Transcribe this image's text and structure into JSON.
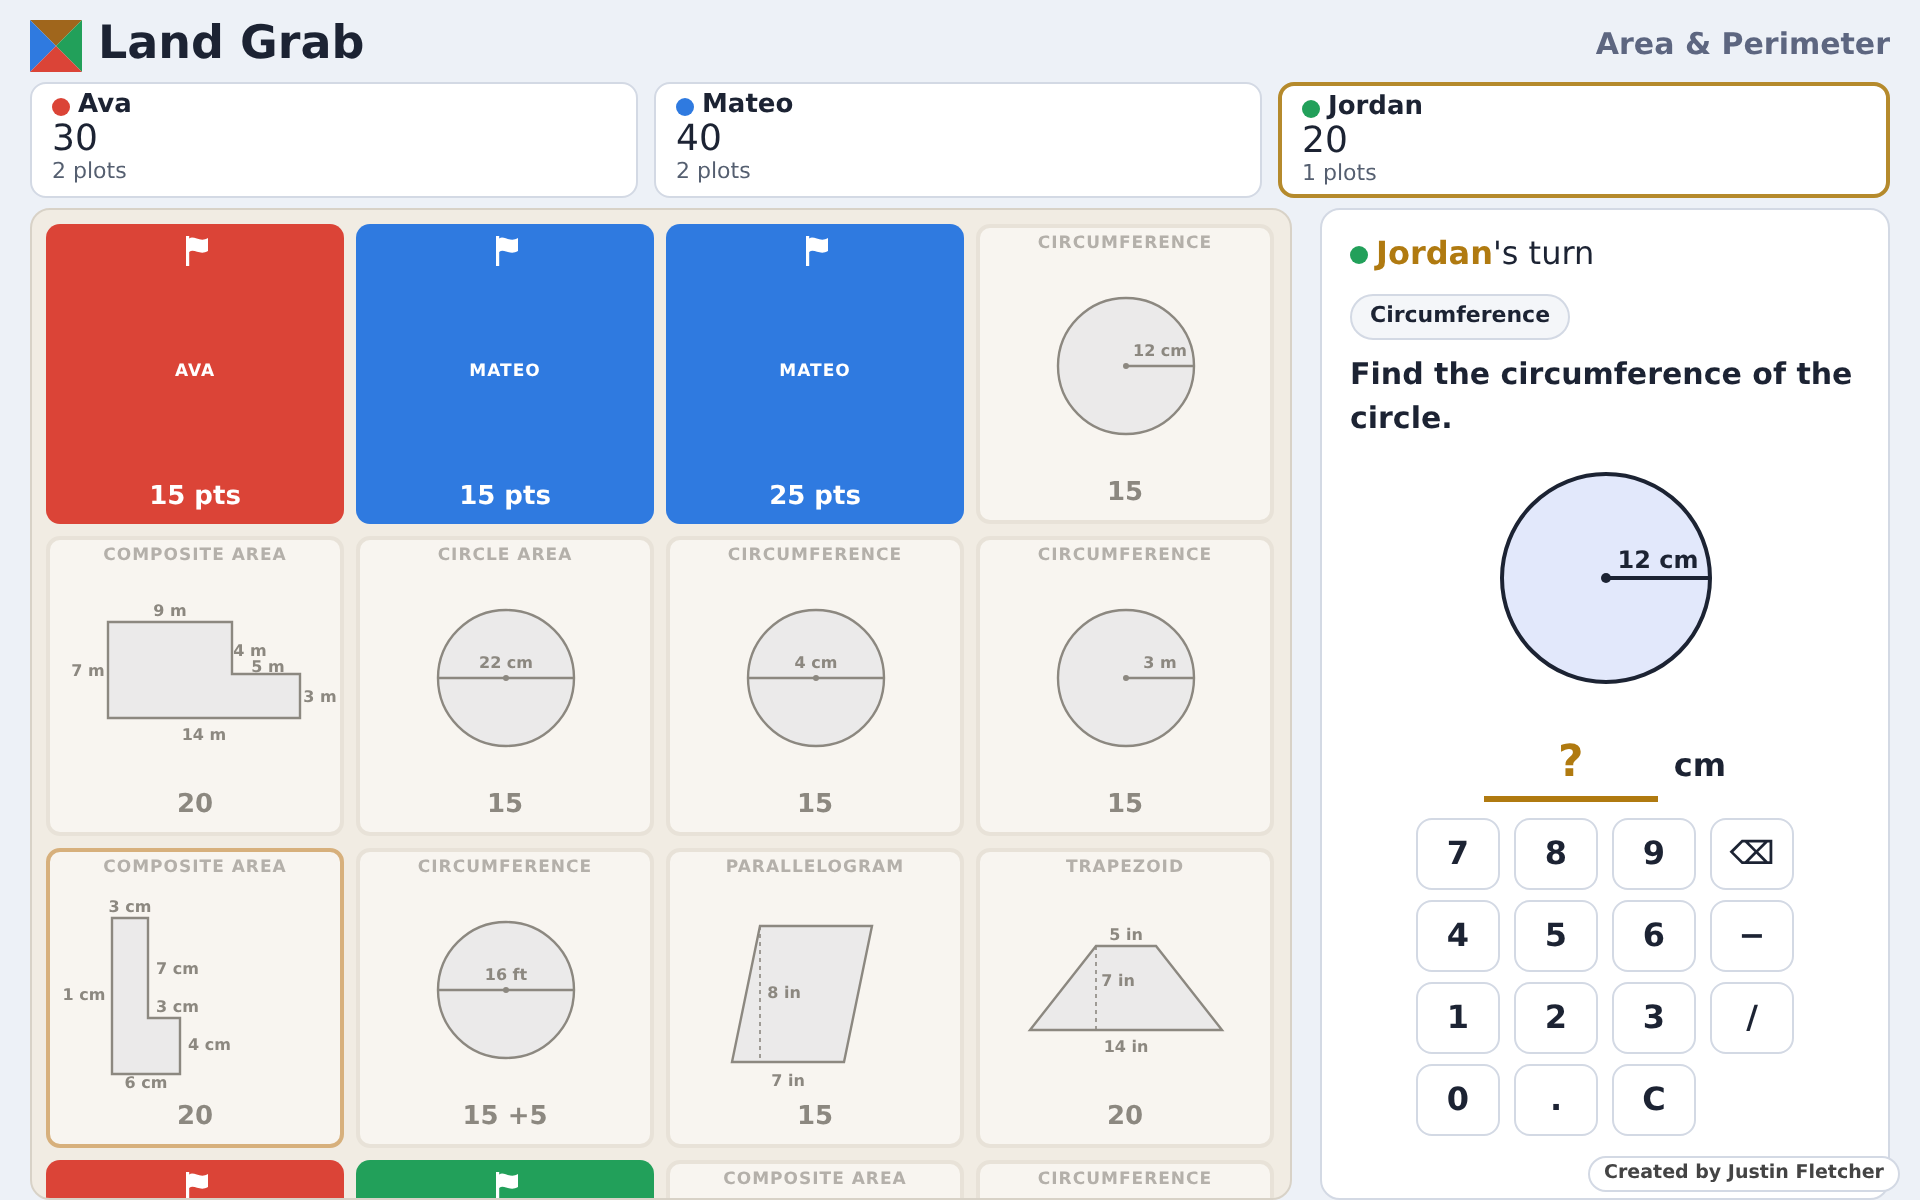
{
  "header": {
    "title": "Land Grab",
    "subtitle": "Area & Perimeter"
  },
  "players": [
    {
      "name": "Ava",
      "color": "#db4437",
      "score": "30",
      "plots": "2 plots",
      "selected": false
    },
    {
      "name": "Mateo",
      "color": "#2f7ae0",
      "score": "40",
      "plots": "2 plots",
      "selected": false
    },
    {
      "name": "Jordan",
      "color": "#22a05a",
      "score": "20",
      "plots": "1 plots",
      "selected": true
    }
  ],
  "board": {
    "tiles": [
      {
        "kind": "owned",
        "color": "#db4437",
        "owner": "AVA",
        "points": "15 pts"
      },
      {
        "kind": "owned",
        "color": "#2f7ae0",
        "owner": "MATEO",
        "points": "15 pts"
      },
      {
        "kind": "owned",
        "color": "#2f7ae0",
        "owner": "MATEO",
        "points": "25 pts"
      },
      {
        "kind": "open",
        "title": "CIRCUMFERENCE",
        "figure": {
          "kind": "radius",
          "labels": [
            "12 cm"
          ]
        },
        "points": "15",
        "selected": false
      },
      {
        "kind": "open",
        "title": "COMPOSITE AREA",
        "figure": {
          "kind": "step",
          "labels": [
            "9 m",
            "7 m",
            "4 m",
            "5 m",
            "3 m",
            "14 m"
          ]
        },
        "points": "20",
        "selected": false
      },
      {
        "kind": "open",
        "title": "CIRCLE AREA",
        "figure": {
          "kind": "diameter",
          "labels": [
            "22 cm"
          ]
        },
        "points": "15",
        "selected": false
      },
      {
        "kind": "open",
        "title": "CIRCUMFERENCE",
        "figure": {
          "kind": "diameter",
          "labels": [
            "4 cm"
          ]
        },
        "points": "15",
        "selected": false
      },
      {
        "kind": "open",
        "title": "CIRCUMFERENCE",
        "figure": {
          "kind": "radius",
          "labels": [
            "3 m"
          ]
        },
        "points": "15",
        "selected": false
      },
      {
        "kind": "open",
        "title": "COMPOSITE AREA",
        "figure": {
          "kind": "ell",
          "labels": [
            "3 cm",
            "7 cm",
            "1 cm",
            "3 cm",
            "4 cm",
            "6 cm"
          ]
        },
        "points": "20",
        "selected": true
      },
      {
        "kind": "open",
        "title": "CIRCUMFERENCE",
        "figure": {
          "kind": "diameter",
          "labels": [
            "16 ft"
          ]
        },
        "points": "15 +5",
        "selected": false
      },
      {
        "kind": "open",
        "title": "PARALLELOGRAM",
        "figure": {
          "kind": "parallelogram",
          "labels": [
            "8 in",
            "7 in"
          ]
        },
        "points": "15",
        "selected": false
      },
      {
        "kind": "open",
        "title": "TRAPEZOID",
        "figure": {
          "kind": "trapezoid",
          "labels": [
            "5 in",
            "7 in",
            "14 in"
          ]
        },
        "points": "20",
        "selected": false
      },
      {
        "kind": "owned",
        "color": "#db4437"
      },
      {
        "kind": "owned",
        "color": "#22a05a"
      },
      {
        "kind": "open",
        "title": "COMPOSITE AREA",
        "selected": false
      },
      {
        "kind": "open",
        "title": "CIRCUMFERENCE",
        "selected": false
      }
    ]
  },
  "turn": {
    "color": "#22a05a",
    "player": "Jordan",
    "suffix": "'s turn",
    "tag": "Circumference",
    "question": "Find the circumference of the circle.",
    "figure": {
      "kind": "radius",
      "labels": [
        "12 cm"
      ]
    },
    "answer": {
      "placeholder": "?",
      "unit": "cm"
    },
    "keys": [
      "7",
      "8",
      "9",
      "⌫",
      "4",
      "5",
      "6",
      "−",
      "1",
      "2",
      "3",
      "/",
      "0",
      ".",
      "C"
    ]
  },
  "credit": "Created by Justin Fletcher"
}
